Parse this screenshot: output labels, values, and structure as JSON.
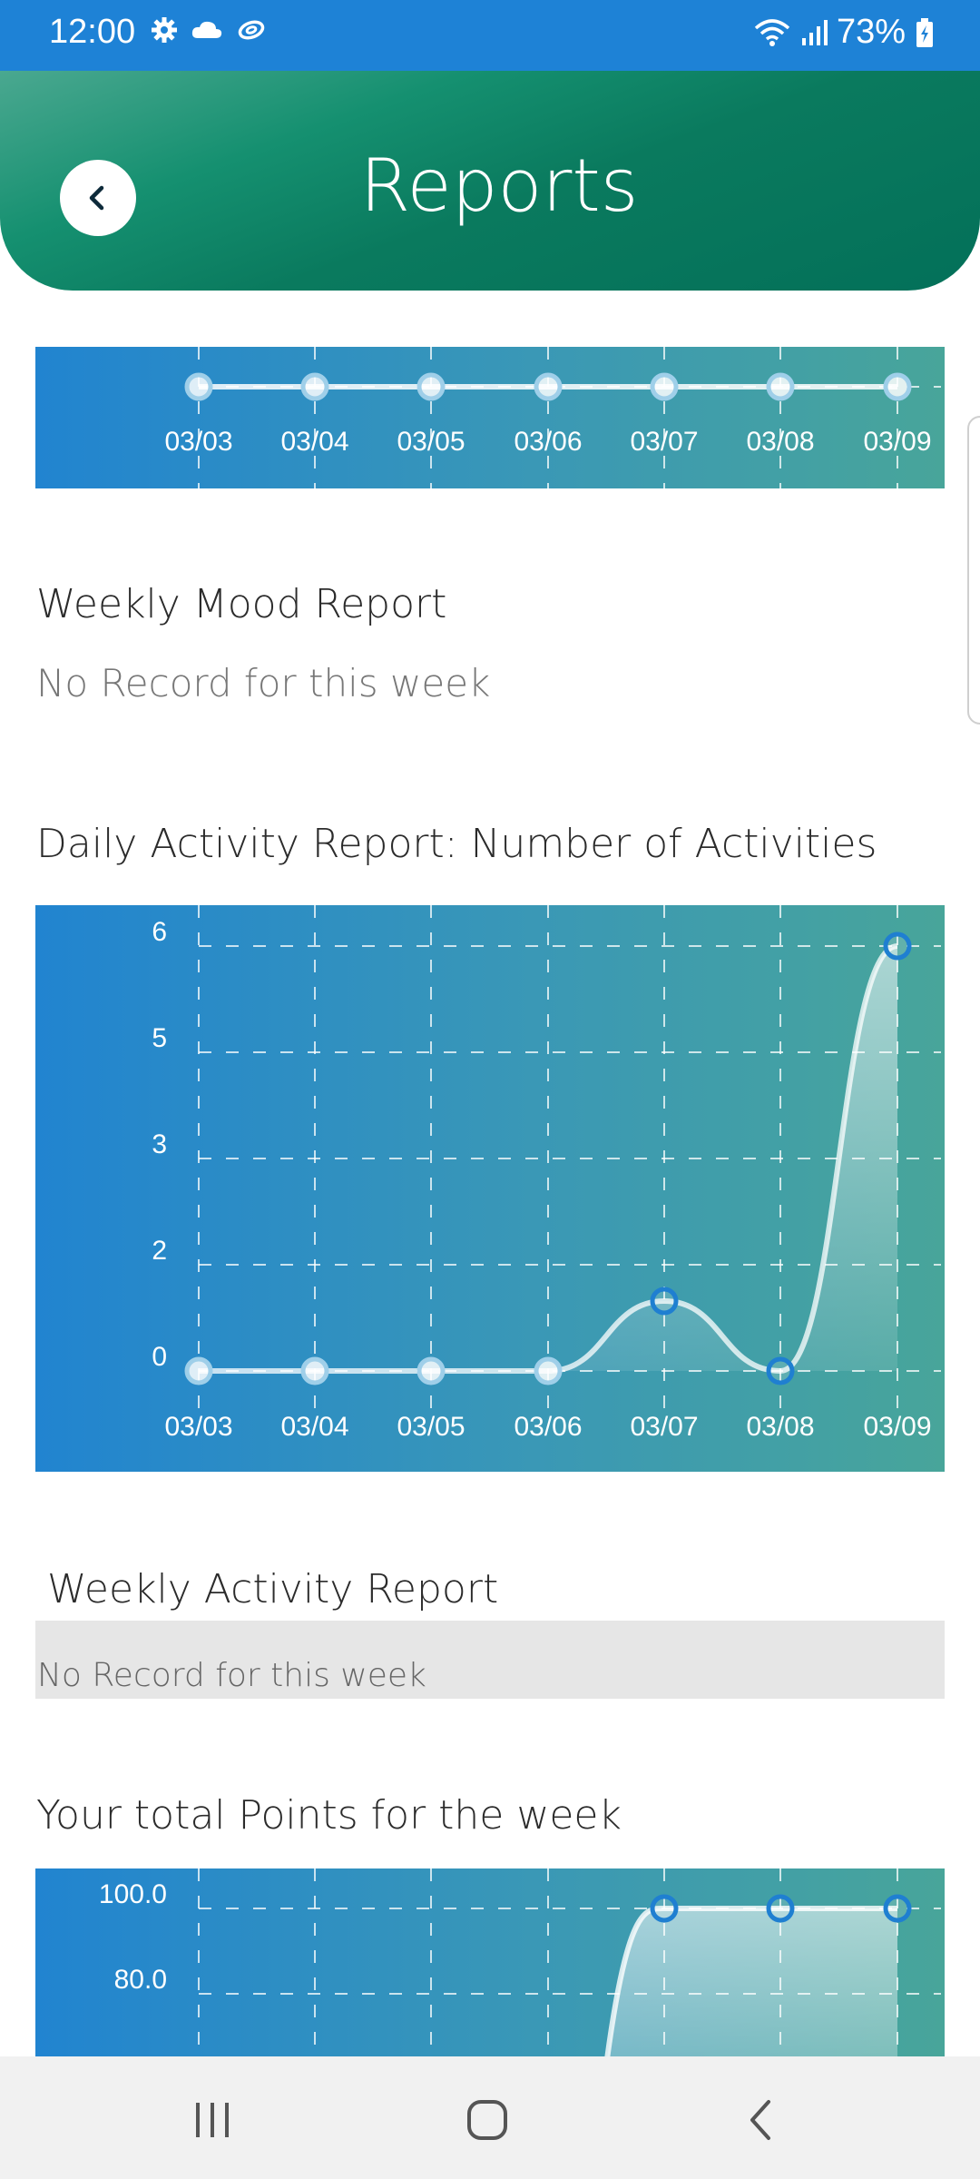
{
  "status_bar": {
    "time": "12:00",
    "battery": "73%",
    "icons": [
      "gear-icon",
      "cloud-icon",
      "sync-icon",
      "wifi-icon",
      "signal-icon",
      "battery-icon"
    ]
  },
  "header": {
    "title": "Reports",
    "back_icon": "chevron-left-icon"
  },
  "sections": {
    "weekly_mood": {
      "title": "Weekly Mood Report",
      "empty": "No Record for this week"
    },
    "daily_activity": {
      "title": "Daily Activity Report: Number of Activities"
    },
    "weekly_activity": {
      "title": "Weekly Activity Report",
      "empty": "No Record for this week"
    },
    "total_points": {
      "title": "Your total Points for the week"
    }
  },
  "colors": {
    "status_bar": "#1e82d6",
    "header_dark": "#037059",
    "header_light": "#4aa890",
    "chart_left": "#2184d0",
    "chart_right": "#48a59a"
  },
  "chart_data": [
    {
      "type": "line",
      "x": [
        "03/03",
        "03/04",
        "03/05",
        "03/06",
        "03/07",
        "03/08",
        "03/09"
      ],
      "series": [
        {
          "values": [
            0,
            0,
            0,
            0,
            0,
            0,
            0
          ]
        }
      ],
      "grid": true
    },
    {
      "type": "area",
      "x": [
        "03/03",
        "03/04",
        "03/05",
        "03/06",
        "03/07",
        "03/08",
        "03/09"
      ],
      "series": [
        {
          "values": [
            0,
            0,
            0,
            0,
            1,
            0,
            6
          ]
        }
      ],
      "yticks": [
        "0",
        "2",
        "3",
        "5",
        "6"
      ],
      "ylim": [
        0,
        6
      ],
      "grid": true
    },
    {
      "type": "area",
      "x": [
        "03/03",
        "03/04",
        "03/05",
        "03/06",
        "03/07",
        "03/08",
        "03/09"
      ],
      "series": [
        {
          "values": [
            null,
            null,
            null,
            null,
            100.0,
            100.0,
            100.0
          ]
        }
      ],
      "yticks": [
        "100.0",
        "80.0"
      ],
      "grid": true
    }
  ],
  "nav_bar": {
    "icons": [
      "recent-apps-icon",
      "home-icon",
      "back-icon"
    ]
  }
}
